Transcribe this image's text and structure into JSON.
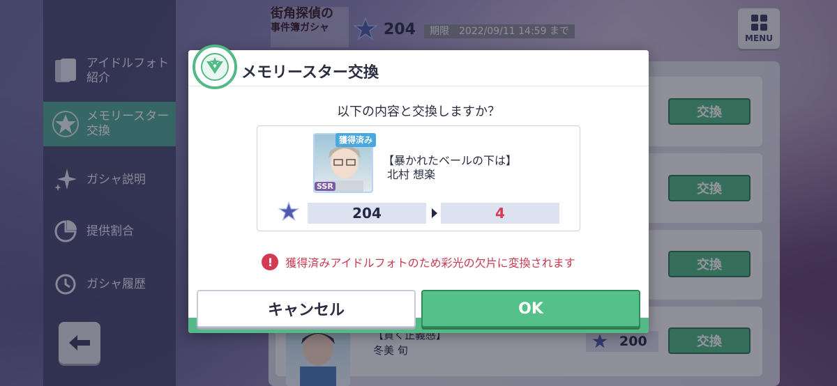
{
  "sidebar": {
    "items": [
      {
        "label": "アイドルフォト\n紹介",
        "icon": "photo-cards-icon",
        "active": false
      },
      {
        "label": "メモリースター\n交換",
        "icon": "star-icon",
        "active": true
      },
      {
        "label": "ガシャ説明",
        "icon": "sparkle-icon",
        "active": false
      },
      {
        "label": "提供割合",
        "icon": "pie-chart-icon",
        "active": false
      },
      {
        "label": "ガシャ履歴",
        "icon": "history-icon",
        "active": false
      }
    ],
    "back_icon": "back-arrow-icon"
  },
  "header": {
    "gacha_logo_line1": "街角探偵の",
    "gacha_logo_line2": "事件簿ガシャ",
    "star_count": "204",
    "period": "期限　2022/09/11 14:59 まで",
    "menu_label": "MENU"
  },
  "list": {
    "exchange_label": "交換",
    "visible_row": {
      "title": "【貫く正義感】",
      "name": "冬美 旬",
      "cost": "200"
    }
  },
  "dialog": {
    "title": "メモリースター交換",
    "question": "以下の内容と交換しますか？",
    "card": {
      "obtained_badge": "獲得済み",
      "rarity": "SSR",
      "title": "【暴かれたベールの下は】",
      "name": "北村 想楽"
    },
    "cost_before": "204",
    "cost_after": "4",
    "warning": "獲得済みアイドルフォトのため彩光の欠片に変換されます",
    "cancel_label": "キャンセル",
    "ok_label": "OK"
  },
  "colors": {
    "accent_green": "#52b987",
    "warning_red": "#d33b53",
    "sidebar_active": "#54a99a"
  }
}
